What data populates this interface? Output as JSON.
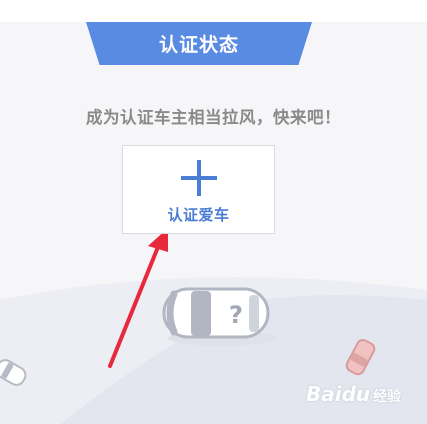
{
  "status": {
    "title": "认证状态"
  },
  "promo": {
    "text": "成为认证车主相当拉风，快来吧！"
  },
  "cert_card": {
    "label": "认证爱车",
    "icon": "plus-icon"
  },
  "car_placeholder": {
    "mark": "?",
    "icon": "car-question-icon"
  },
  "watermark": {
    "brand": "Baidu",
    "suffix": "经验"
  },
  "colors": {
    "accent": "#5a8be2",
    "card_label": "#4a7ed6",
    "promo_text": "#8a8a8a",
    "arrow": "#e8283b",
    "road": "#e7e9f1"
  }
}
